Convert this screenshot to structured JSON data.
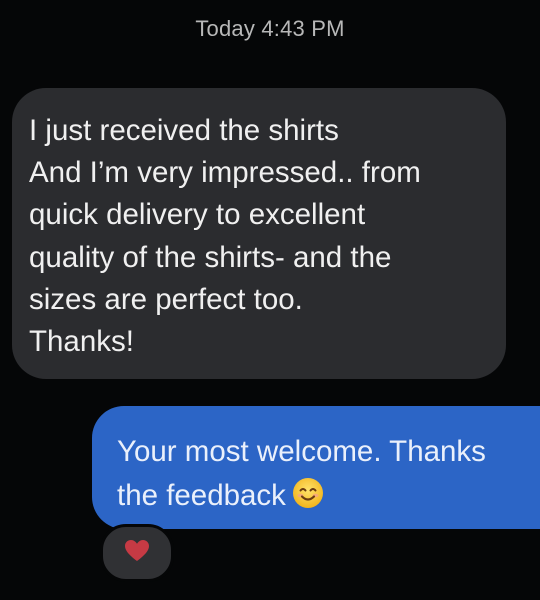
{
  "conversation": {
    "timestamp": "Today 4:43 PM",
    "incoming": {
      "lines": [
        "I just received the shirts",
        "And I’m very impressed.. from",
        "quick delivery to excellent",
        "quality of the shirts- and the",
        "sizes are perfect too.",
        "Thanks!"
      ]
    },
    "outgoing": {
      "lines": [
        "Your most welcome. Thanks",
        "the feedback"
      ],
      "emoji": "smiling-face-icon"
    },
    "reaction": {
      "icon": "heart-icon",
      "color": "#c63a44"
    }
  },
  "colors": {
    "background": "#050607",
    "incoming_bubble": "#2b2c2f",
    "outgoing_bubble": "#2c65c6",
    "timestamp_text": "#b8b8b8"
  }
}
